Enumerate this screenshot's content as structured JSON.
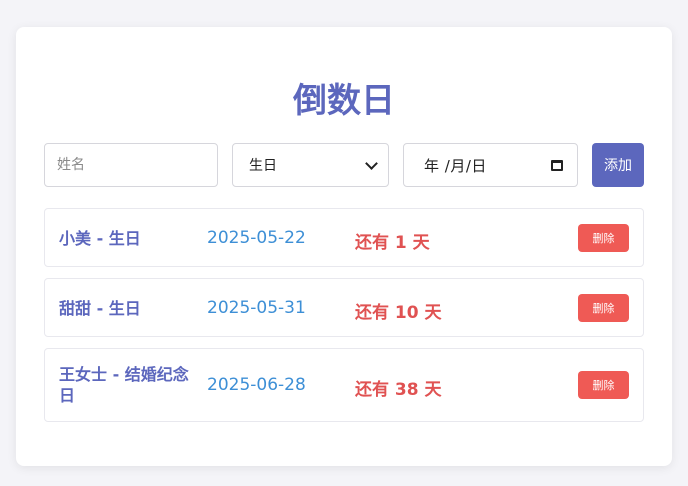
{
  "title": "倒数日",
  "form": {
    "name_placeholder": "姓名",
    "type_selected": "生日",
    "date_value": "年 /月/日",
    "add_label": "添加"
  },
  "events": [
    {
      "name": "小美 - 生日",
      "date": "2025-05-22",
      "remaining": "还有 1 天",
      "delete_label": "删除"
    },
    {
      "name": "甜甜 - 生日",
      "date": "2025-05-31",
      "remaining": "还有 10 天",
      "delete_label": "删除"
    },
    {
      "name": "王女士 - 结婚纪念日",
      "date": "2025-06-28",
      "remaining": "还有 38 天",
      "delete_label": "删除"
    }
  ],
  "colors": {
    "accent": "#5c67bd",
    "date_blue": "#3d8fd6",
    "countdown_red": "#e05252",
    "delete_red": "#ef5a55",
    "background": "#f4f4f8"
  }
}
